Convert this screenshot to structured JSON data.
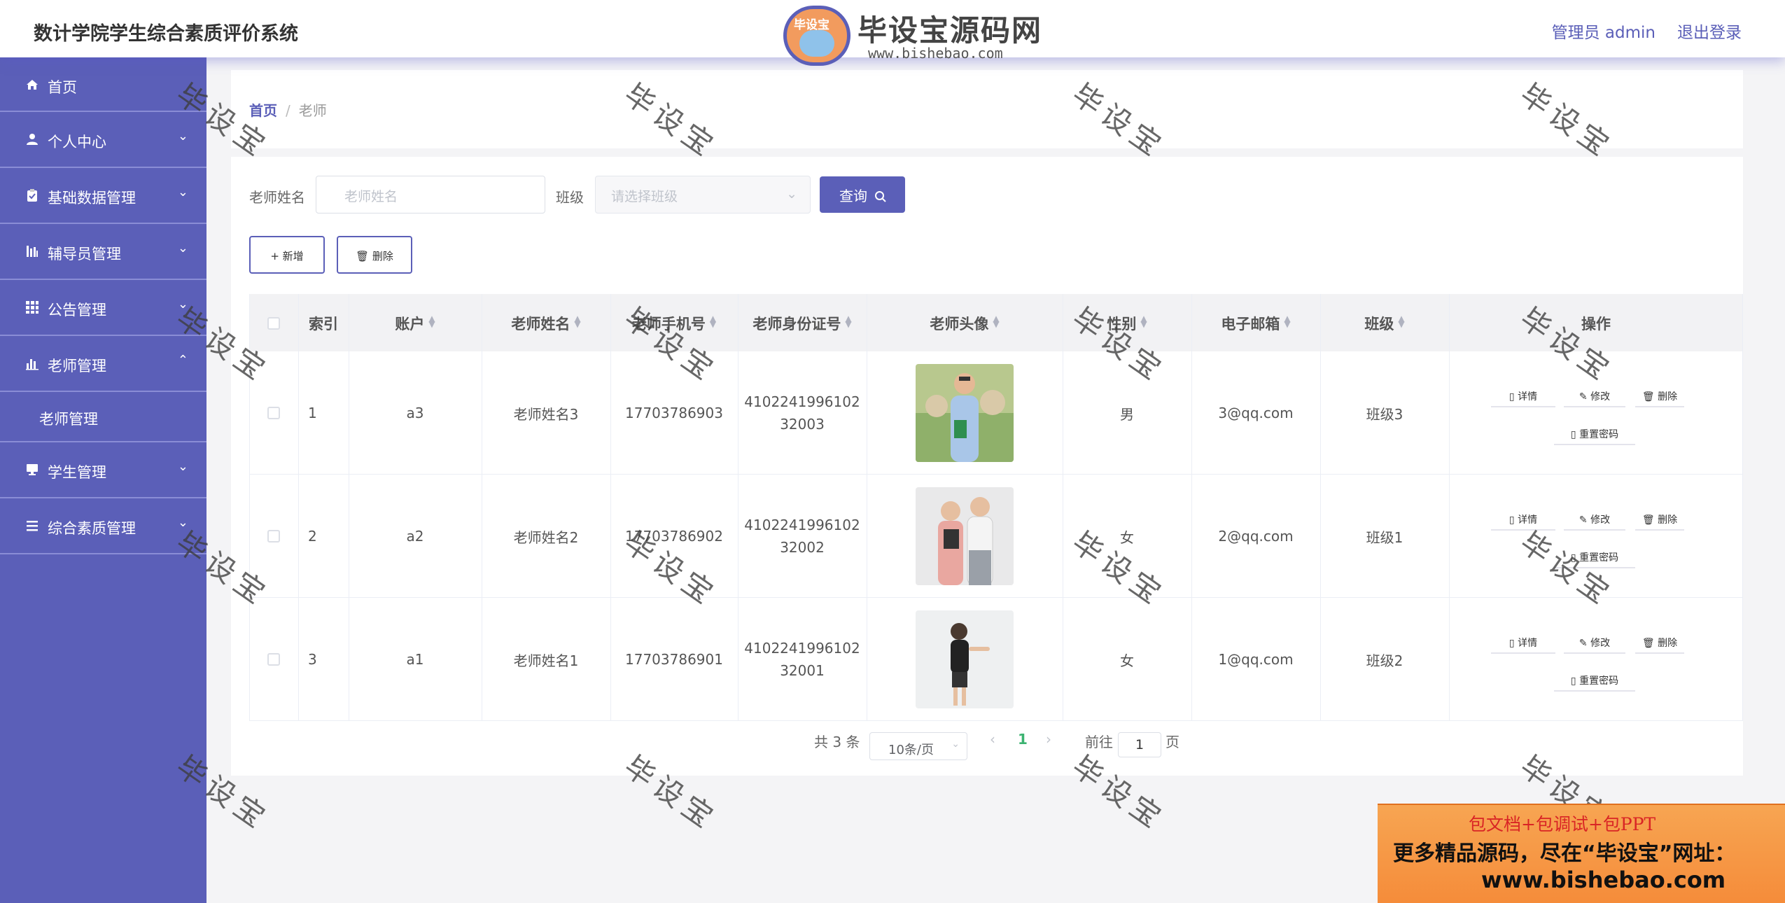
{
  "header": {
    "app_title": "数计学院学生综合素质评价系统",
    "user_info": "管理员 admin",
    "logout_label": "退出登录"
  },
  "logo": {
    "badge_text": "毕设宝",
    "name": "毕设宝源码网",
    "url": "www.bishebao.com"
  },
  "sidebar": {
    "items": [
      {
        "label": "首页",
        "icon": "home-icon"
      },
      {
        "label": "个人中心",
        "icon": "user-icon"
      },
      {
        "label": "基础数据管理",
        "icon": "clipboard-icon"
      },
      {
        "label": "辅导员管理",
        "icon": "chart-icon"
      },
      {
        "label": "公告管理",
        "icon": "grid-icon"
      },
      {
        "label": "老师管理",
        "icon": "bar-chart-icon"
      },
      {
        "label": "学生管理",
        "icon": "monitor-icon"
      },
      {
        "label": "综合素质管理",
        "icon": "list-icon"
      }
    ],
    "submenu": {
      "label": "老师管理"
    }
  },
  "breadcrumb": {
    "home": "首页",
    "separator": "/",
    "current": "老师"
  },
  "search": {
    "teacher_name_label": "老师姓名",
    "teacher_name_placeholder": "老师姓名",
    "class_label": "班级",
    "class_placeholder": "请选择班级",
    "query_label": "查询"
  },
  "toolbar": {
    "add_label": "+ 新增",
    "delete_label": "删除"
  },
  "table": {
    "headers": [
      "索引",
      "账户",
      "老师姓名",
      "老师手机号",
      "老师身份证号",
      "老师头像",
      "性别",
      "电子邮箱",
      "班级",
      "操作"
    ],
    "rows": [
      {
        "index": "1",
        "account": "a3",
        "name": "老师姓名3",
        "phone": "17703786903",
        "id_line1": "4102241996102",
        "id_line2": "32003",
        "gender": "男",
        "email": "3@qq.com",
        "class": "班级3"
      },
      {
        "index": "2",
        "account": "a2",
        "name": "老师姓名2",
        "phone": "17703786902",
        "id_line1": "4102241996102",
        "id_line2": "32002",
        "gender": "女",
        "email": "2@qq.com",
        "class": "班级1"
      },
      {
        "index": "3",
        "account": "a1",
        "name": "老师姓名1",
        "phone": "17703786901",
        "id_line1": "4102241996102",
        "id_line2": "32001",
        "gender": "女",
        "email": "1@qq.com",
        "class": "班级2"
      }
    ],
    "actions": {
      "detail": "详情",
      "edit": "修改",
      "delete": "删除",
      "reset_password": "重置密码"
    }
  },
  "pagination": {
    "total": "共 3 条",
    "page_size": "10条/页",
    "current_page": "1",
    "goto_label": "前往",
    "goto_value": "1",
    "page_suffix": "页"
  },
  "watermark": {
    "text": "毕设宝"
  },
  "banner": {
    "line1": "包文档+包调试+包PPT",
    "line2": "更多精品源码，尽在“毕设宝”网址：",
    "line3": "www.bishebao.com"
  },
  "colors": {
    "accent": "#5b5fb8",
    "active_page": "#3cb371"
  }
}
